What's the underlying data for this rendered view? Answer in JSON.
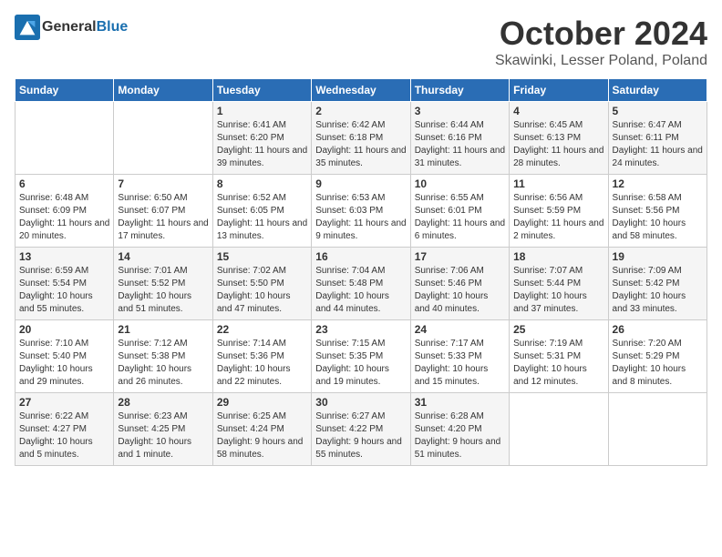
{
  "header": {
    "logo": {
      "general": "General",
      "blue": "Blue"
    },
    "title": "October 2024",
    "location": "Skawinki, Lesser Poland, Poland"
  },
  "days_of_week": [
    "Sunday",
    "Monday",
    "Tuesday",
    "Wednesday",
    "Thursday",
    "Friday",
    "Saturday"
  ],
  "weeks": [
    [
      {
        "day": "",
        "info": ""
      },
      {
        "day": "",
        "info": ""
      },
      {
        "day": "1",
        "info": "Sunrise: 6:41 AM\nSunset: 6:20 PM\nDaylight: 11 hours and 39 minutes."
      },
      {
        "day": "2",
        "info": "Sunrise: 6:42 AM\nSunset: 6:18 PM\nDaylight: 11 hours and 35 minutes."
      },
      {
        "day": "3",
        "info": "Sunrise: 6:44 AM\nSunset: 6:16 PM\nDaylight: 11 hours and 31 minutes."
      },
      {
        "day": "4",
        "info": "Sunrise: 6:45 AM\nSunset: 6:13 PM\nDaylight: 11 hours and 28 minutes."
      },
      {
        "day": "5",
        "info": "Sunrise: 6:47 AM\nSunset: 6:11 PM\nDaylight: 11 hours and 24 minutes."
      }
    ],
    [
      {
        "day": "6",
        "info": "Sunrise: 6:48 AM\nSunset: 6:09 PM\nDaylight: 11 hours and 20 minutes."
      },
      {
        "day": "7",
        "info": "Sunrise: 6:50 AM\nSunset: 6:07 PM\nDaylight: 11 hours and 17 minutes."
      },
      {
        "day": "8",
        "info": "Sunrise: 6:52 AM\nSunset: 6:05 PM\nDaylight: 11 hours and 13 minutes."
      },
      {
        "day": "9",
        "info": "Sunrise: 6:53 AM\nSunset: 6:03 PM\nDaylight: 11 hours and 9 minutes."
      },
      {
        "day": "10",
        "info": "Sunrise: 6:55 AM\nSunset: 6:01 PM\nDaylight: 11 hours and 6 minutes."
      },
      {
        "day": "11",
        "info": "Sunrise: 6:56 AM\nSunset: 5:59 PM\nDaylight: 11 hours and 2 minutes."
      },
      {
        "day": "12",
        "info": "Sunrise: 6:58 AM\nSunset: 5:56 PM\nDaylight: 10 hours and 58 minutes."
      }
    ],
    [
      {
        "day": "13",
        "info": "Sunrise: 6:59 AM\nSunset: 5:54 PM\nDaylight: 10 hours and 55 minutes."
      },
      {
        "day": "14",
        "info": "Sunrise: 7:01 AM\nSunset: 5:52 PM\nDaylight: 10 hours and 51 minutes."
      },
      {
        "day": "15",
        "info": "Sunrise: 7:02 AM\nSunset: 5:50 PM\nDaylight: 10 hours and 47 minutes."
      },
      {
        "day": "16",
        "info": "Sunrise: 7:04 AM\nSunset: 5:48 PM\nDaylight: 10 hours and 44 minutes."
      },
      {
        "day": "17",
        "info": "Sunrise: 7:06 AM\nSunset: 5:46 PM\nDaylight: 10 hours and 40 minutes."
      },
      {
        "day": "18",
        "info": "Sunrise: 7:07 AM\nSunset: 5:44 PM\nDaylight: 10 hours and 37 minutes."
      },
      {
        "day": "19",
        "info": "Sunrise: 7:09 AM\nSunset: 5:42 PM\nDaylight: 10 hours and 33 minutes."
      }
    ],
    [
      {
        "day": "20",
        "info": "Sunrise: 7:10 AM\nSunset: 5:40 PM\nDaylight: 10 hours and 29 minutes."
      },
      {
        "day": "21",
        "info": "Sunrise: 7:12 AM\nSunset: 5:38 PM\nDaylight: 10 hours and 26 minutes."
      },
      {
        "day": "22",
        "info": "Sunrise: 7:14 AM\nSunset: 5:36 PM\nDaylight: 10 hours and 22 minutes."
      },
      {
        "day": "23",
        "info": "Sunrise: 7:15 AM\nSunset: 5:35 PM\nDaylight: 10 hours and 19 minutes."
      },
      {
        "day": "24",
        "info": "Sunrise: 7:17 AM\nSunset: 5:33 PM\nDaylight: 10 hours and 15 minutes."
      },
      {
        "day": "25",
        "info": "Sunrise: 7:19 AM\nSunset: 5:31 PM\nDaylight: 10 hours and 12 minutes."
      },
      {
        "day": "26",
        "info": "Sunrise: 7:20 AM\nSunset: 5:29 PM\nDaylight: 10 hours and 8 minutes."
      }
    ],
    [
      {
        "day": "27",
        "info": "Sunrise: 6:22 AM\nSunset: 4:27 PM\nDaylight: 10 hours and 5 minutes."
      },
      {
        "day": "28",
        "info": "Sunrise: 6:23 AM\nSunset: 4:25 PM\nDaylight: 10 hours and 1 minute."
      },
      {
        "day": "29",
        "info": "Sunrise: 6:25 AM\nSunset: 4:24 PM\nDaylight: 9 hours and 58 minutes."
      },
      {
        "day": "30",
        "info": "Sunrise: 6:27 AM\nSunset: 4:22 PM\nDaylight: 9 hours and 55 minutes."
      },
      {
        "day": "31",
        "info": "Sunrise: 6:28 AM\nSunset: 4:20 PM\nDaylight: 9 hours and 51 minutes."
      },
      {
        "day": "",
        "info": ""
      },
      {
        "day": "",
        "info": ""
      }
    ]
  ]
}
